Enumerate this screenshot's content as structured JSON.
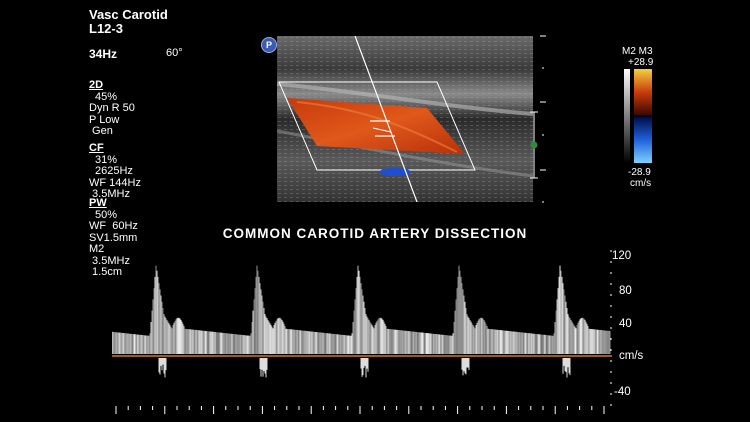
{
  "header": {
    "preset": "Vasc Carotid",
    "probe": "L12-3",
    "frame_rate": "34Hz",
    "angle": "60°"
  },
  "params_2d": {
    "heading": "2D",
    "lines": [
      "45%",
      "Dyn R 50",
      "P Low",
      " Gen"
    ]
  },
  "params_cf": {
    "heading": "CF",
    "lines": [
      "31%",
      "2625Hz",
      "WF 144Hz",
      " 3.5MHz"
    ]
  },
  "params_pw": {
    "heading": "PW",
    "lines": [
      "50%",
      "WF  60Hz",
      "SV1.5mm",
      "M2",
      " 3.5MHz",
      " 1.5cm"
    ]
  },
  "probe_marker": "P",
  "colorbar": {
    "map_label": "M2 M3",
    "max": "+28.9",
    "min": "-28.9",
    "unit": "cm/s",
    "colors": {
      "positive": "#d24a10",
      "negative": "#1f5fd8"
    }
  },
  "title": "COMMON CAROTID ARTERY DISSECTION",
  "velocity_scale": {
    "labels": [
      "120",
      "80",
      "40",
      "cm/s",
      "-40"
    ],
    "values": [
      120,
      80,
      40,
      0,
      -40
    ],
    "baseline_color": "#d9791c"
  },
  "spectral": {
    "beats": 5,
    "peak_velocity": 110
  }
}
